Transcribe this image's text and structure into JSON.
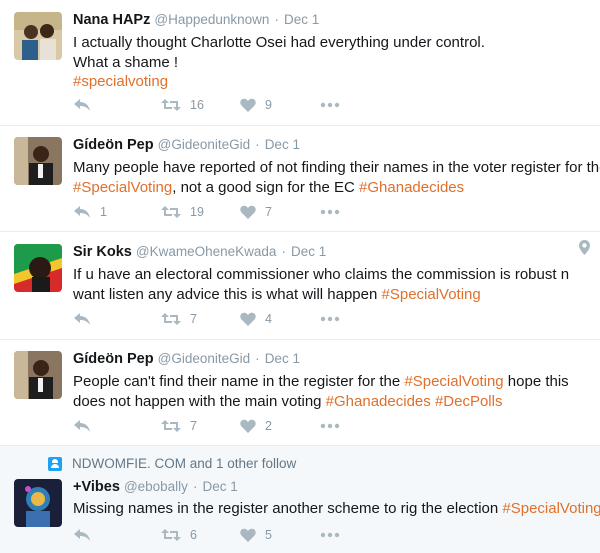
{
  "colors": {
    "hashtag": "#e0702b",
    "muted": "#8899a6",
    "divider": "#e6ecf0",
    "tinted_row": "#f5f8fa",
    "context_icon": "#1da1f2"
  },
  "tweets": [
    {
      "name": "Nana HAPz",
      "handle": "@Happedunknown",
      "separator": "·",
      "time": "Dec 1",
      "lines": [
        "I actually thought Charlotte Osei had everything under control.",
        "What a shame !"
      ],
      "tag_line": "#specialvoting",
      "reply_count": "",
      "retweet_count": "16",
      "like_count": "9"
    },
    {
      "name": "Gídeön Pep",
      "handle": "@GideoniteGid",
      "separator": "·",
      "time": "Dec 1",
      "line1": "Many people have reported of not finding their names in the voter register for the",
      "line2_tag1": "#SpecialVoting",
      "line2_text": ", not a good sign for the EC ",
      "line2_tag2": "#Ghanadecides",
      "reply_count": "1",
      "retweet_count": "19",
      "like_count": "7"
    },
    {
      "name": "Sir Koks",
      "handle": "@KwameOheneKwada",
      "separator": "·",
      "time": "Dec 1",
      "line1": "If u have an electoral commissioner who claims the commission is robust  n",
      "line2_text": "want listen any advice this is what will happen ",
      "line2_tag": "#SpecialVoting",
      "reply_count": "",
      "retweet_count": "7",
      "like_count": "4",
      "location_icon": "map-pin-icon"
    },
    {
      "name": "Gídeön Pep",
      "handle": "@GideoniteGid",
      "separator": "·",
      "time": "Dec 1",
      "line1_text": "People can't find their name in the register for the ",
      "line1_tag": "#SpecialVoting",
      "line1_tail": " hope this",
      "line2_text": "does not happen with the main voting ",
      "line2_tag1": "#Ghanadecides",
      "line2_gap": " ",
      "line2_tag2": "#DecPolls",
      "reply_count": "",
      "retweet_count": "7",
      "like_count": "2"
    },
    {
      "context": "NDWOMFIE. COM and 1 other follow",
      "name": "+Vibes",
      "handle": "@ebobally",
      "separator": "·",
      "time": "Dec 1",
      "line1_text": "Missing names in the register another scheme to rig the election ",
      "line1_tag": "#SpecialVoting",
      "reply_count": "",
      "retweet_count": "6",
      "like_count": "5"
    }
  ],
  "icons": {
    "reply": "reply-icon",
    "retweet": "retweet-icon",
    "like": "heart-icon",
    "more": "more-dots-icon"
  }
}
